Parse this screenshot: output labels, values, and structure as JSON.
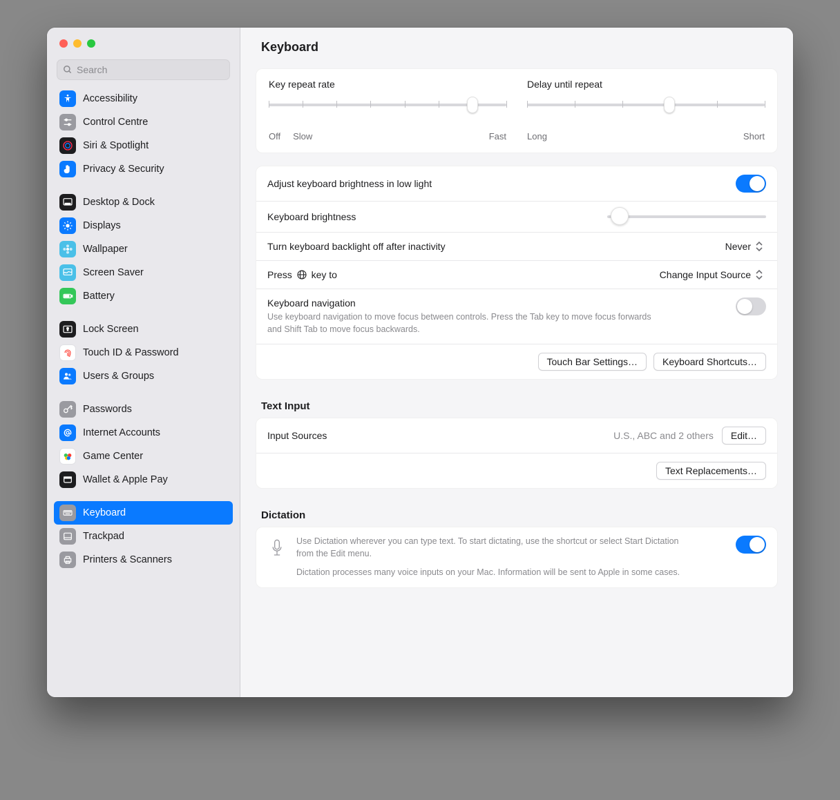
{
  "search": {
    "placeholder": "Search"
  },
  "sidebar": {
    "items": [
      {
        "label": "Accessibility",
        "icon": "accessibility",
        "bg": "#0a7aff",
        "fg": "#fff"
      },
      {
        "label": "Control Centre",
        "icon": "sliders",
        "bg": "#9a9aa0",
        "fg": "#fff"
      },
      {
        "label": "Siri & Spotlight",
        "icon": "siri",
        "bg": "#1d1d1f",
        "fg": "#fff"
      },
      {
        "label": "Privacy & Security",
        "icon": "hand",
        "bg": "#0a7aff",
        "fg": "#fff"
      },
      {
        "label": "Desktop & Dock",
        "icon": "dock",
        "bg": "#1d1d1f",
        "fg": "#fff"
      },
      {
        "label": "Displays",
        "icon": "sun",
        "bg": "#0a7aff",
        "fg": "#fff"
      },
      {
        "label": "Wallpaper",
        "icon": "flower",
        "bg": "#4ac0e8",
        "fg": "#fff"
      },
      {
        "label": "Screen Saver",
        "icon": "screensaver",
        "bg": "#4ac0e8",
        "fg": "#fff"
      },
      {
        "label": "Battery",
        "icon": "battery",
        "bg": "#34c759",
        "fg": "#fff"
      },
      {
        "label": "Lock Screen",
        "icon": "lock",
        "bg": "#1d1d1f",
        "fg": "#fff"
      },
      {
        "label": "Touch ID & Password",
        "icon": "fingerprint",
        "bg": "#ffffff",
        "fg": "#ff3b30"
      },
      {
        "label": "Users & Groups",
        "icon": "users",
        "bg": "#0a7aff",
        "fg": "#fff"
      },
      {
        "label": "Passwords",
        "icon": "key",
        "bg": "#9a9aa0",
        "fg": "#fff"
      },
      {
        "label": "Internet Accounts",
        "icon": "at",
        "bg": "#0a7aff",
        "fg": "#fff"
      },
      {
        "label": "Game Center",
        "icon": "game",
        "bg": "#ffffff",
        "fg": "#34c759"
      },
      {
        "label": "Wallet & Apple Pay",
        "icon": "wallet",
        "bg": "#1d1d1f",
        "fg": "#fff"
      },
      {
        "label": "Keyboard",
        "icon": "keyboard",
        "bg": "#9a9aa0",
        "fg": "#fff"
      },
      {
        "label": "Trackpad",
        "icon": "trackpad",
        "bg": "#9a9aa0",
        "fg": "#fff"
      },
      {
        "label": "Printers & Scanners",
        "icon": "printer",
        "bg": "#9a9aa0",
        "fg": "#fff"
      }
    ],
    "selected": "Keyboard",
    "group_breaks_after": [
      3,
      8,
      11,
      15
    ]
  },
  "main": {
    "title": "Keyboard",
    "repeat": {
      "rate_label": "Key repeat rate",
      "rate_left": "Off",
      "rate_left2": "Slow",
      "rate_right": "Fast",
      "rate_ticks": 8,
      "rate_value_index": 6,
      "delay_label": "Delay until repeat",
      "delay_left": "Long",
      "delay_right": "Short",
      "delay_ticks": 6,
      "delay_value_index": 3
    },
    "brightness_auto": {
      "label": "Adjust keyboard brightness in low light",
      "on": true
    },
    "brightness_slider": {
      "label": "Keyboard brightness",
      "value_pct": 2
    },
    "backlight_off": {
      "label": "Turn keyboard backlight off after inactivity",
      "value": "Never"
    },
    "globe_key": {
      "label_prefix": "Press ",
      "label_suffix": " key to",
      "value": "Change Input Source"
    },
    "nav": {
      "label": "Keyboard navigation",
      "on": false,
      "desc": "Use keyboard navigation to move focus between controls. Press the Tab key to move focus forwards and Shift Tab to move focus backwards."
    },
    "buttons_a": {
      "touchbar": "Touch Bar Settings…",
      "shortcuts": "Keyboard Shortcuts…"
    },
    "text_input": {
      "section_title": "Text Input",
      "input_sources_label": "Input Sources",
      "input_sources_value": "U.S., ABC and 2 others",
      "edit_button": "Edit…",
      "replacements_button": "Text Replacements…"
    },
    "dictation": {
      "section_title": "Dictation",
      "on": true,
      "desc1": "Use Dictation wherever you can type text. To start dictating, use the shortcut or select Start Dictation from the Edit menu.",
      "desc2": "Dictation processes many voice inputs on your Mac. Information will be sent to Apple in some cases."
    }
  }
}
